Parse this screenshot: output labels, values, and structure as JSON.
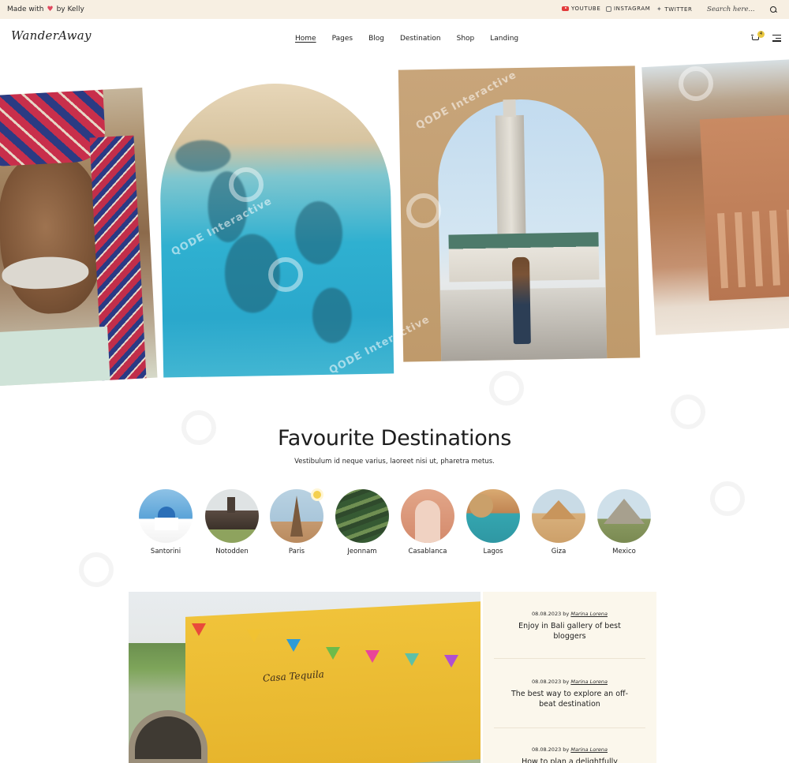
{
  "topbar": {
    "made_with_prefix": "Made with",
    "made_with_suffix": "by Kelly",
    "social": [
      "YOUTUBE",
      "INSTAGRAM",
      "TWITTER"
    ],
    "search_placeholder": "Search here..."
  },
  "nav": {
    "logo": "WanderAway",
    "menu": [
      "Home",
      "Pages",
      "Blog",
      "Destination",
      "Shop",
      "Landing"
    ],
    "active": "Home",
    "cart_count": "4"
  },
  "watermark": "QODE Interactive",
  "destinations": {
    "title": "Favourite Destinations",
    "subtitle": "Vestibulum id neque varius, laoreet nisi ut, pharetra metus.",
    "items": [
      "Santorini",
      "Notodden",
      "Paris",
      "Jeonnam",
      "Casablanca",
      "Lagos",
      "Giza",
      "Mexico"
    ]
  },
  "posts": [
    {
      "date": "08.08.2023",
      "by": "by",
      "author": "Marina Lorena",
      "title": "Enjoy in Bali gallery of best bloggers"
    },
    {
      "date": "08.08.2023",
      "by": "by",
      "author": "Marina Lorena",
      "title": "The best way to explore an off-beat destination"
    },
    {
      "date": "08.08.2023",
      "by": "by",
      "author": "Marina Lorena",
      "title": "How to plan a delightfully"
    }
  ],
  "colors": {
    "topbar_bg": "#f7efe2",
    "posts_bg": "#fbf7ec",
    "heart": "#e0485e",
    "youtube": "#e23a3a",
    "cart_badge": "#e9c840"
  }
}
